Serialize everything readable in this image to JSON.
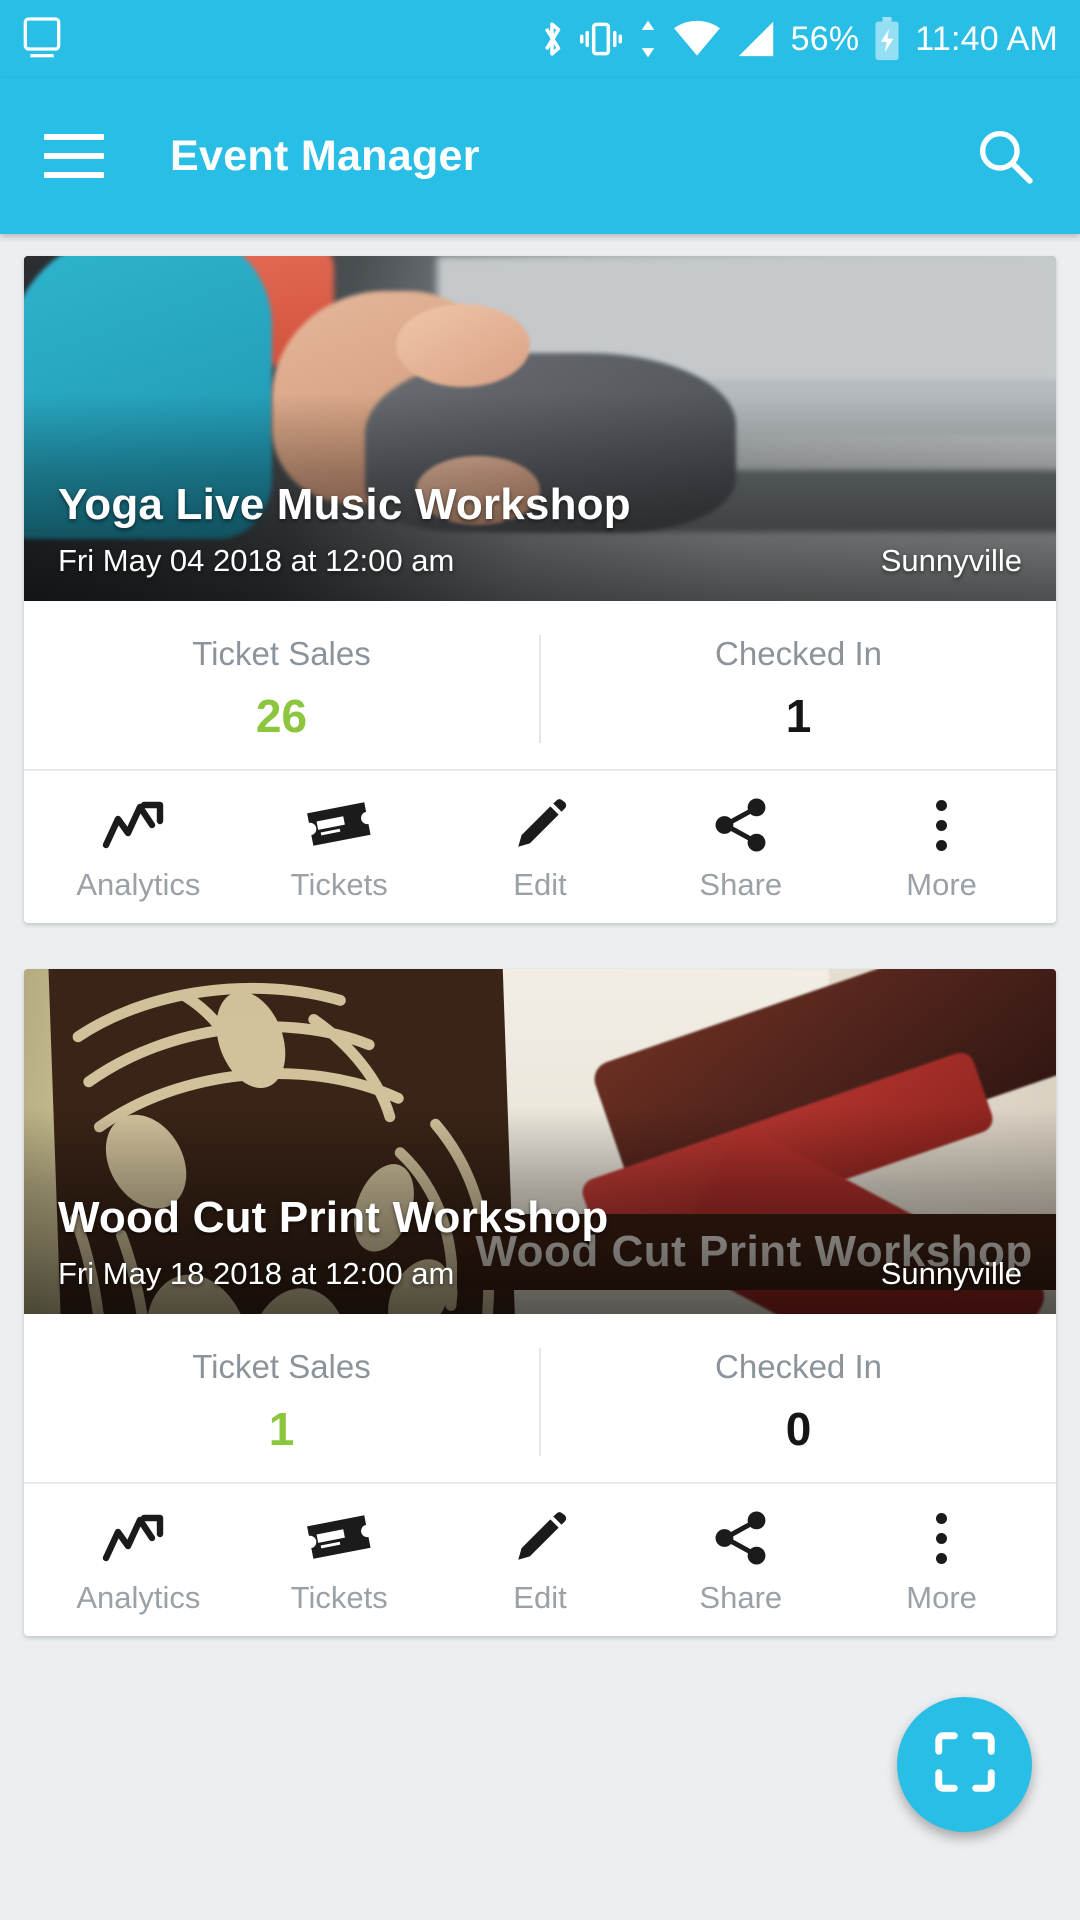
{
  "status_bar": {
    "icons": [
      "tablet-icon",
      "bluetooth-icon",
      "vibrate-icon",
      "data-transfer-icon",
      "wifi-icon",
      "signal-icon"
    ],
    "battery_percent": "56%",
    "battery_icon": "battery-charging-icon",
    "time": "11:40 AM"
  },
  "app_bar": {
    "menu_icon": "hamburger-menu-icon",
    "title": "Event Manager",
    "search_icon": "search-icon"
  },
  "colors": {
    "accent": "#29BEE6",
    "value_positive": "#8CC63E",
    "value_dark": "#151515",
    "label_gray": "#8B949B",
    "page_background": "#ECEFF1"
  },
  "actions": [
    {
      "label": "Analytics",
      "icon": "trending-up-icon"
    },
    {
      "label": "Tickets",
      "icon": "ticket-icon"
    },
    {
      "label": "Edit",
      "icon": "pencil-icon"
    },
    {
      "label": "Share",
      "icon": "share-icon"
    },
    {
      "label": "More",
      "icon": "overflow-dots-icon"
    }
  ],
  "stat_labels": {
    "ticket_sales": "Ticket Sales",
    "checked_in": "Checked In"
  },
  "events": [
    {
      "title": "Yoga Live Music Workshop",
      "date": "Fri May 04 2018 at 12:00 am",
      "location": "Sunnyville",
      "ticket_sales": "26",
      "checked_in": "1"
    },
    {
      "title": "Wood Cut Print Workshop",
      "date": "Fri May 18 2018 at 12:00 am",
      "location": "Sunnyville",
      "ticket_sales": "1",
      "checked_in": "0",
      "image_banner_text": "Wood Cut Print Workshop"
    }
  ],
  "fab": {
    "icon": "qr-scan-icon"
  }
}
